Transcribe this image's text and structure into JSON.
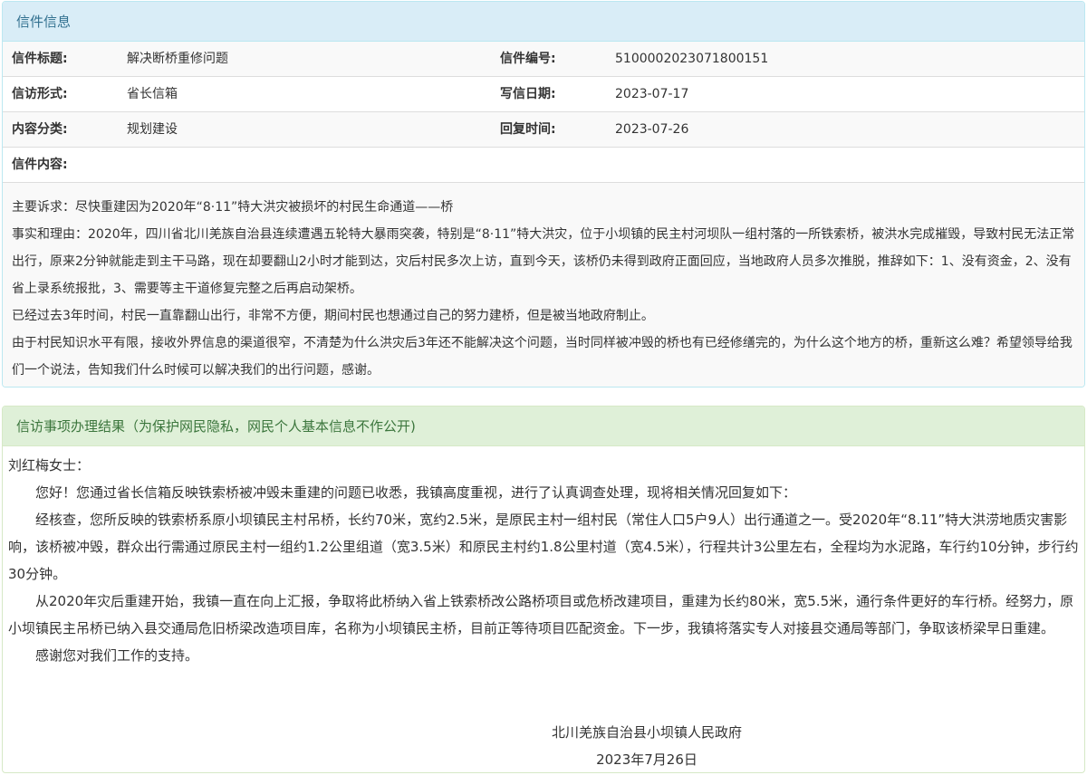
{
  "letter_panel": {
    "title": "信件信息",
    "rows": [
      {
        "label1": "信件标题:",
        "value1": "解决断桥重修问题",
        "label2": "信件编号:",
        "value2": "5100002023071800151"
      },
      {
        "label1": "信访形式:",
        "value1": "省长信箱",
        "label2": "写信日期:",
        "value2": "2023-07-17"
      },
      {
        "label1": "内容分类:",
        "value1": "规划建设",
        "label2": "回复时间:",
        "value2": "2023-07-26"
      }
    ],
    "content_label": "信件内容:",
    "content_paragraphs": [
      "主要诉求：尽快重建因为2020年“8·11”特大洪灾被损坏的村民生命通道——桥",
      "事实和理由：2020年，四川省北川羌族自治县连续遭遇五轮特大暴雨突袭，特别是“8·11”特大洪灾，位于小坝镇的民主村河坝队一组村落的一所铁索桥，被洪水完成摧毁，导致村民无法正常出行，原来2分钟就能走到主干马路，现在却要翻山2小时才能到达，灾后村民多次上访，直到今天，该桥仍未得到政府正面回应，当地政府人员多次推脱，推辞如下：1、没有资金，2、没有省上录系统报批，3、需要等主干道修复完整之后再启动架桥。",
      "已经过去3年时间，村民一直靠翻山出行，非常不方便，期间村民也想通过自己的努力建桥，但是被当地政府制止。",
      "由于村民知识水平有限，接收外界信息的渠道很窄，不清楚为什么洪灾后3年还不能解决这个问题，当时同样被冲毁的桥也有已经修缮完的，为什么这个地方的桥，重新这么难？希望领导给我们一个说法，告知我们什么时候可以解决我们的出行问题，感谢。"
    ]
  },
  "reply_panel": {
    "title": "信访事项办理结果（为保护网民隐私，网民个人基本信息不作公开)",
    "salutation": "刘红梅女士：",
    "paragraphs": [
      "您好！您通过省长信箱反映铁索桥被冲毁未重建的问题已收悉，我镇高度重视，进行了认真调查处理，现将相关情况回复如下：",
      "经核查，您所反映的铁索桥系原小坝镇民主村吊桥，长约70米，宽约2.5米，是原民主村一组村民（常住人口5户9人）出行通道之一。受2020年“8.11”特大洪涝地质灾害影响，该桥被冲毁，群众出行需通过原民主村一组约1.2公里组道（宽3.5米）和原民主村约1.8公里村道（宽4.5米），行程共计3公里左右，全程均为水泥路，车行约10分钟，步行约30分钟。",
      "从2020年灾后重建开始，我镇一直在向上汇报，争取将此桥纳入省上铁索桥改公路桥项目或危桥改建项目，重建为长约80米，宽5.5米，通行条件更好的车行桥。经努力，原小坝镇民主吊桥已纳入县交通局危旧桥梁改造项目库，名称为小坝镇民主桥，目前正等待项目匹配资金。下一步，我镇将落实专人对接县交通局等部门，争取该桥梁早日重建。",
      "感谢您对我们工作的支持。"
    ],
    "signature_org": "北川羌族自治县小坝镇人民政府",
    "signature_date": "2023年7月26日"
  }
}
